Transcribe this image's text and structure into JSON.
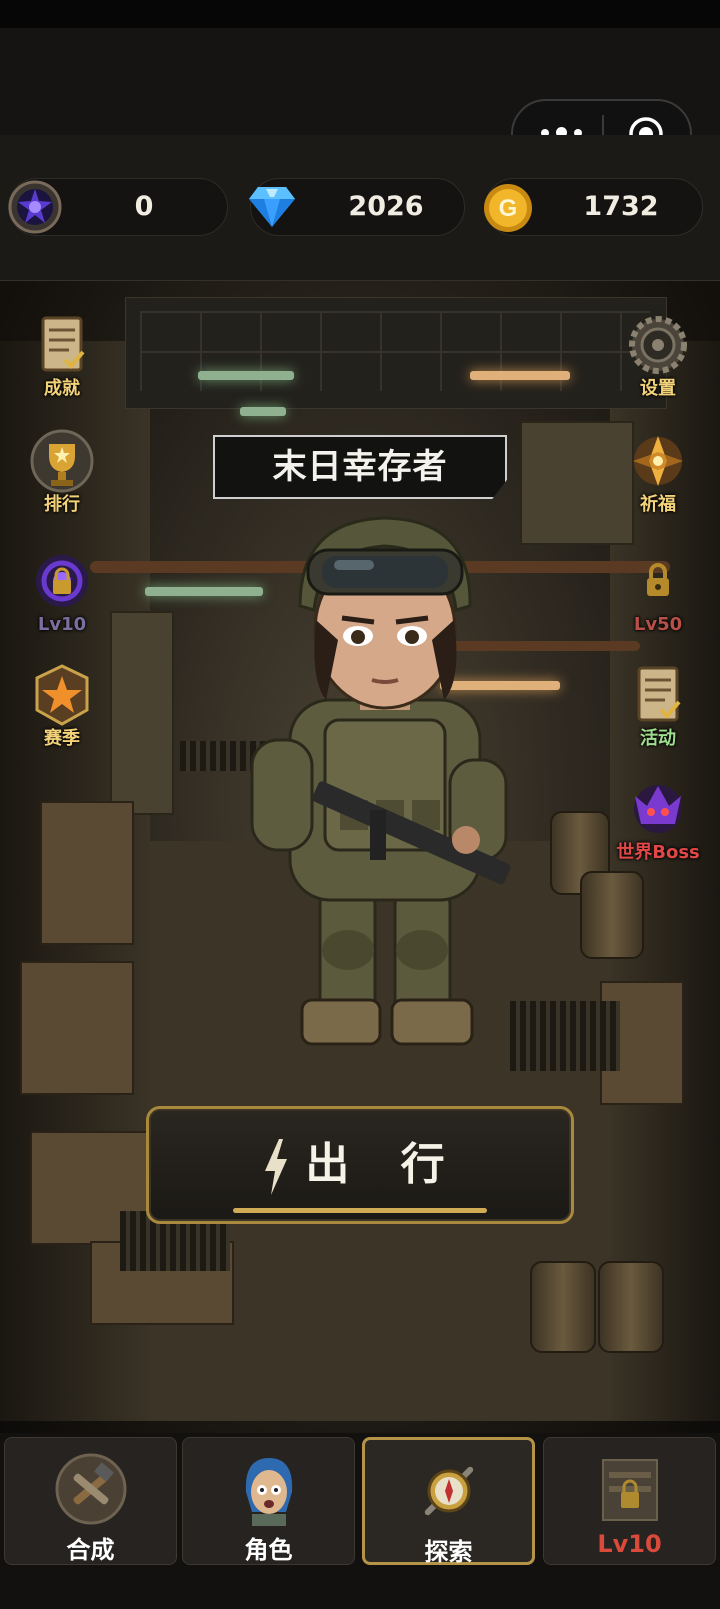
{
  "capsule": {
    "more_icon": "more-dots-icon",
    "close_icon": "target-circle-icon"
  },
  "currency": [
    {
      "name": "crystal",
      "icon": "purple-crystal-icon",
      "value": "0"
    },
    {
      "name": "diamond",
      "icon": "blue-diamond-icon",
      "value": "2026"
    },
    {
      "name": "gold",
      "icon": "gold-coin-icon",
      "value": "1732"
    }
  ],
  "left_menu": [
    {
      "label": "成就",
      "icon": "scroll-icon"
    },
    {
      "label": "排行",
      "icon": "trophy-icon"
    },
    {
      "label": "Lv10",
      "icon": "locked-portal-icon"
    },
    {
      "label": "赛季",
      "icon": "star-badge-icon"
    }
  ],
  "right_menu": [
    {
      "label": "设置",
      "icon": "gear-icon"
    },
    {
      "label": "祈福",
      "icon": "prayer-emblem-icon"
    },
    {
      "label": "Lv50",
      "icon": "locked-icon"
    },
    {
      "label": "活动",
      "icon": "event-scroll-icon"
    },
    {
      "label": "世界Boss",
      "icon": "boss-icon"
    }
  ],
  "title": "末日幸存者",
  "go_button": {
    "label": "出 行",
    "icon": "lightning-icon"
  },
  "tabs": [
    {
      "label": "合成",
      "icon": "craft-tools-icon",
      "active": false
    },
    {
      "label": "角色",
      "icon": "character-icon",
      "active": false
    },
    {
      "label": "探索",
      "icon": "compass-icon",
      "active": true
    },
    {
      "label": "Lv10",
      "icon": "locked-shop-icon",
      "active": false
    }
  ],
  "colors": {
    "accent_gold": "#b59448",
    "label_gold": "#f3d27a",
    "lock_red": "#d94a3b"
  }
}
